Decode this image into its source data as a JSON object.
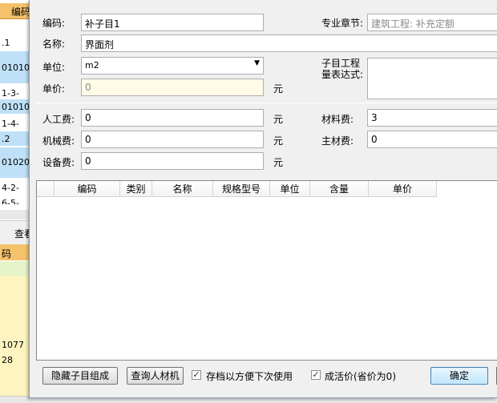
{
  "background_app": {
    "tab_label": "编码",
    "left_cells": [
      ".1",
      "01010",
      "1-3-",
      "01010",
      "1-4-",
      ".2",
      "01020",
      "4-2-",
      "6-5-"
    ],
    "toolbar_fragment": "查看",
    "header_fragment": "码",
    "bottom_cells": [
      "1077",
      "28"
    ]
  },
  "form": {
    "code_label": "编码:",
    "code_value": "补子目1",
    "chapter_label": "专业章节:",
    "chapter_value": "建筑工程: 补充定额",
    "name_label": "名称:",
    "name_value": "界面剂",
    "unit_label": "单位:",
    "unit_value": "m2",
    "qty_expr_label": "子目工程量表达式:",
    "qty_expr_value": "",
    "price_label": "单价:",
    "price_value": "0",
    "yuan": "元"
  },
  "fees": {
    "labor_label": "人工费:",
    "labor_value": "0",
    "material_label": "材料费:",
    "material_value": "3",
    "machine_label": "机械费:",
    "machine_value": "0",
    "main_material_label": "主材费:",
    "main_material_value": "0",
    "equipment_label": "设备费:",
    "equipment_value": "0",
    "yuan": "元"
  },
  "grid": {
    "columns": [
      "编码",
      "类别",
      "名称",
      "规格型号",
      "单位",
      "含量",
      "单价"
    ]
  },
  "footer": {
    "hide_button": "隐藏子目组成",
    "query_button": "查询人材机",
    "save_check_label": "存档以方便下次使用",
    "save_checked": true,
    "cost_check_label": "成活价(省价为0)",
    "cost_checked": true,
    "ok_button": "确定"
  }
}
